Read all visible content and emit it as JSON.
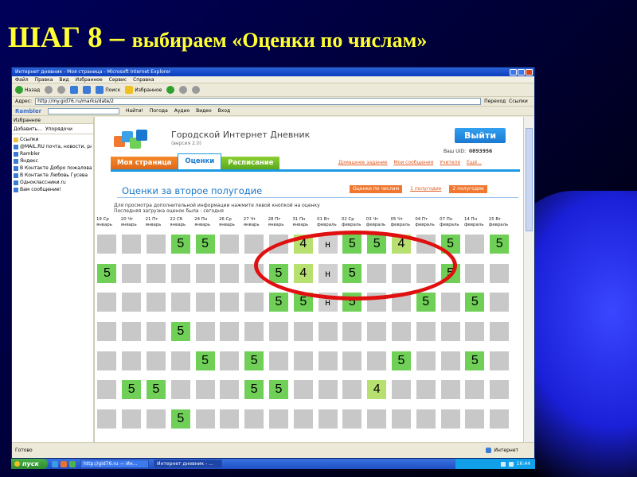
{
  "slide": {
    "title_part1": "ШАГ 8 – ",
    "title_part2": "выбираем «Оценки по числам»"
  },
  "browser": {
    "window_title": "Интернет дневник - Моя страница - Microsoft Internet Explorer",
    "menu": [
      "Файл",
      "Правка",
      "Вид",
      "Избранное",
      "Сервис",
      "Справка"
    ],
    "toolbar": {
      "back": "Назад",
      "search": "Поиск",
      "favorites": "Избранное"
    },
    "address": {
      "label": "Адрес:",
      "url": "http://my.gid76.ru/marks/date/2",
      "go": "Переход",
      "links": "Ссылки"
    },
    "linksbar": {
      "brand": "Rambler",
      "find": "Найти!",
      "items": [
        "Погода",
        "Аудио",
        "Видео",
        "Вход"
      ]
    },
    "status": {
      "text": "Готово",
      "zone": "Интернет"
    }
  },
  "favorites": {
    "title": "Избранное",
    "add": "Добавить...",
    "organize": "Упорядочи",
    "items": [
      "Ссылки",
      "@MAIL.RU почта, новости, раб...",
      "Rambler",
      "Яндекс",
      "В Контакте  Добро пожаловать",
      "В Контакте  Любовь Гусева",
      "Одноклассники.ru",
      "Вам сообщение!"
    ]
  },
  "site": {
    "title": "Городской Интернет Дневник",
    "version": "(версия 2.0)",
    "logout": "Выйти",
    "uid_label": "Ваш UID:",
    "uid_value": "0893956",
    "tabs": [
      "Моя страница",
      "Оценки",
      "Расписание"
    ],
    "sublinks": [
      "Домашнее задание",
      "Мои сообщения",
      "Учителя",
      "Ещё..."
    ],
    "section_title": "Оценки за второе полугодие",
    "period_buttons": [
      "Оценки по числам",
      "1 полугодие",
      "2 полугодие"
    ],
    "info_line1": "Для просмотра дополнительной информации нажмите левой кнопкой на оценку",
    "info_line2": "Последняя загрузка оценок была : сегодня"
  },
  "dates": [
    [
      "19 Ср",
      "январь"
    ],
    [
      "20 Чт",
      "январь"
    ],
    [
      "21 Пт",
      "январь"
    ],
    [
      "22 Сб",
      "январь"
    ],
    [
      "24 Пн",
      "январь"
    ],
    [
      "26 Ср",
      "январь"
    ],
    [
      "27 Чт",
      "январь"
    ],
    [
      "28 Пт",
      "январь"
    ],
    [
      "31 Пн",
      "январь"
    ],
    [
      "01 Вт",
      "февраль"
    ],
    [
      "02 Ср",
      "февраль"
    ],
    [
      "03 Чт",
      "февраль"
    ],
    [
      "05 Чт",
      "февраль"
    ],
    [
      "04 Пт",
      "февраль"
    ],
    [
      "07 Пн",
      "февраль"
    ],
    [
      "14 Пн",
      "февраль"
    ],
    [
      "15 Вт",
      "февраль"
    ]
  ],
  "grades": [
    [
      [
        "g",
        ""
      ],
      [
        "g",
        ""
      ],
      [
        "g",
        ""
      ],
      [
        "G",
        "5"
      ],
      [
        "G",
        "5"
      ],
      [
        "g",
        ""
      ],
      [
        "g",
        ""
      ],
      [
        "g",
        ""
      ],
      [
        "L",
        "4"
      ],
      [
        "n",
        "н"
      ],
      [
        "G",
        "5"
      ],
      [
        "G",
        "5"
      ],
      [
        "L",
        "4"
      ],
      [
        "g",
        ""
      ],
      [
        "G",
        "5"
      ],
      [
        "g",
        ""
      ],
      [
        "G",
        "5"
      ]
    ],
    [
      [
        "G",
        "5"
      ],
      [
        "g",
        ""
      ],
      [
        "g",
        ""
      ],
      [
        "g",
        ""
      ],
      [
        "g",
        ""
      ],
      [
        "g",
        ""
      ],
      [
        "g",
        ""
      ],
      [
        "G",
        "5"
      ],
      [
        "L",
        "4"
      ],
      [
        "n",
        "н"
      ],
      [
        "G",
        "5"
      ],
      [
        "g",
        ""
      ],
      [
        "g",
        ""
      ],
      [
        "g",
        ""
      ],
      [
        "G",
        "5"
      ],
      [
        "g",
        ""
      ],
      [
        "g",
        ""
      ]
    ],
    [
      [
        "g",
        ""
      ],
      [
        "g",
        ""
      ],
      [
        "g",
        ""
      ],
      [
        "g",
        ""
      ],
      [
        "g",
        ""
      ],
      [
        "g",
        ""
      ],
      [
        "g",
        ""
      ],
      [
        "G",
        "5"
      ],
      [
        "G",
        "5"
      ],
      [
        "n",
        "н"
      ],
      [
        "G",
        "5"
      ],
      [
        "g",
        ""
      ],
      [
        "g",
        ""
      ],
      [
        "G",
        "5"
      ],
      [
        "g",
        ""
      ],
      [
        "G",
        "5"
      ],
      [
        "g",
        ""
      ]
    ],
    [
      [
        "g",
        ""
      ],
      [
        "g",
        ""
      ],
      [
        "g",
        ""
      ],
      [
        "G",
        "5"
      ],
      [
        "g",
        ""
      ],
      [
        "g",
        ""
      ],
      [
        "g",
        ""
      ],
      [
        "g",
        ""
      ],
      [
        "g",
        ""
      ],
      [
        "g",
        ""
      ],
      [
        "g",
        ""
      ],
      [
        "g",
        ""
      ],
      [
        "g",
        ""
      ],
      [
        "g",
        ""
      ],
      [
        "g",
        ""
      ],
      [
        "g",
        ""
      ],
      [
        "g",
        ""
      ]
    ],
    [
      [
        "g",
        ""
      ],
      [
        "g",
        ""
      ],
      [
        "g",
        ""
      ],
      [
        "g",
        ""
      ],
      [
        "G",
        "5"
      ],
      [
        "g",
        ""
      ],
      [
        "G",
        "5"
      ],
      [
        "g",
        ""
      ],
      [
        "g",
        ""
      ],
      [
        "g",
        ""
      ],
      [
        "g",
        ""
      ],
      [
        "g",
        ""
      ],
      [
        "G",
        "5"
      ],
      [
        "g",
        ""
      ],
      [
        "g",
        ""
      ],
      [
        "G",
        "5"
      ],
      [
        "g",
        ""
      ]
    ],
    [
      [
        "g",
        ""
      ],
      [
        "G",
        "5"
      ],
      [
        "G",
        "5"
      ],
      [
        "g",
        ""
      ],
      [
        "g",
        ""
      ],
      [
        "g",
        ""
      ],
      [
        "G",
        "5"
      ],
      [
        "G",
        "5"
      ],
      [
        "g",
        ""
      ],
      [
        "g",
        ""
      ],
      [
        "g",
        ""
      ],
      [
        "L",
        "4"
      ],
      [
        "g",
        ""
      ],
      [
        "g",
        ""
      ],
      [
        "g",
        ""
      ],
      [
        "g",
        ""
      ],
      [
        "g",
        ""
      ]
    ],
    [
      [
        "g",
        ""
      ],
      [
        "g",
        ""
      ],
      [
        "g",
        ""
      ],
      [
        "G",
        "5"
      ],
      [
        "g",
        ""
      ],
      [
        "g",
        ""
      ],
      [
        "g",
        ""
      ],
      [
        "g",
        ""
      ],
      [
        "g",
        ""
      ],
      [
        "g",
        ""
      ],
      [
        "g",
        ""
      ],
      [
        "g",
        ""
      ],
      [
        "g",
        ""
      ],
      [
        "g",
        ""
      ],
      [
        "g",
        ""
      ],
      [
        "g",
        ""
      ],
      [
        "g",
        ""
      ]
    ]
  ],
  "taskbar": {
    "start": "пуск",
    "items": [
      "http://gid76.ru — Ин...",
      "Интернет дневник - ..."
    ],
    "clock": "16:44"
  },
  "colors": {
    "title_yellow": "#ffff33",
    "grade_green": "#6fcf57",
    "grade_lime": "#b8e070",
    "highlight_red": "#e01010",
    "accent_blue": "#1a9ae0"
  }
}
